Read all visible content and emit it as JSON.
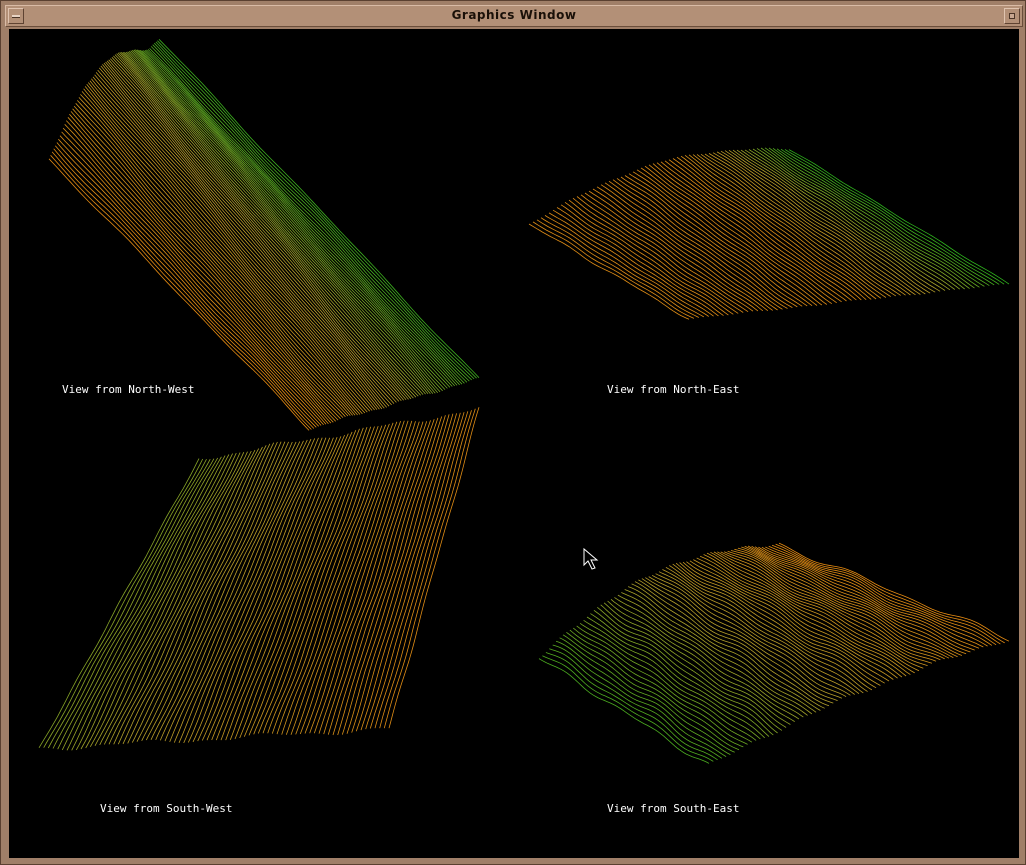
{
  "window": {
    "title": "Graphics Window"
  },
  "views": [
    {
      "label": "View from North-West"
    },
    {
      "label": "View from North-East"
    },
    {
      "label": "View from South-West"
    },
    {
      "label": "View from South-East"
    }
  ],
  "colors": {
    "background": "#000000",
    "frame": "#a07f68",
    "low": "#22c81e",
    "mid": "#c8b030",
    "high": "#ff9a14"
  },
  "icons": {
    "pointer": "mouse-pointer-icon",
    "menu": "window-menu-icon",
    "maximize": "maximize-icon"
  }
}
